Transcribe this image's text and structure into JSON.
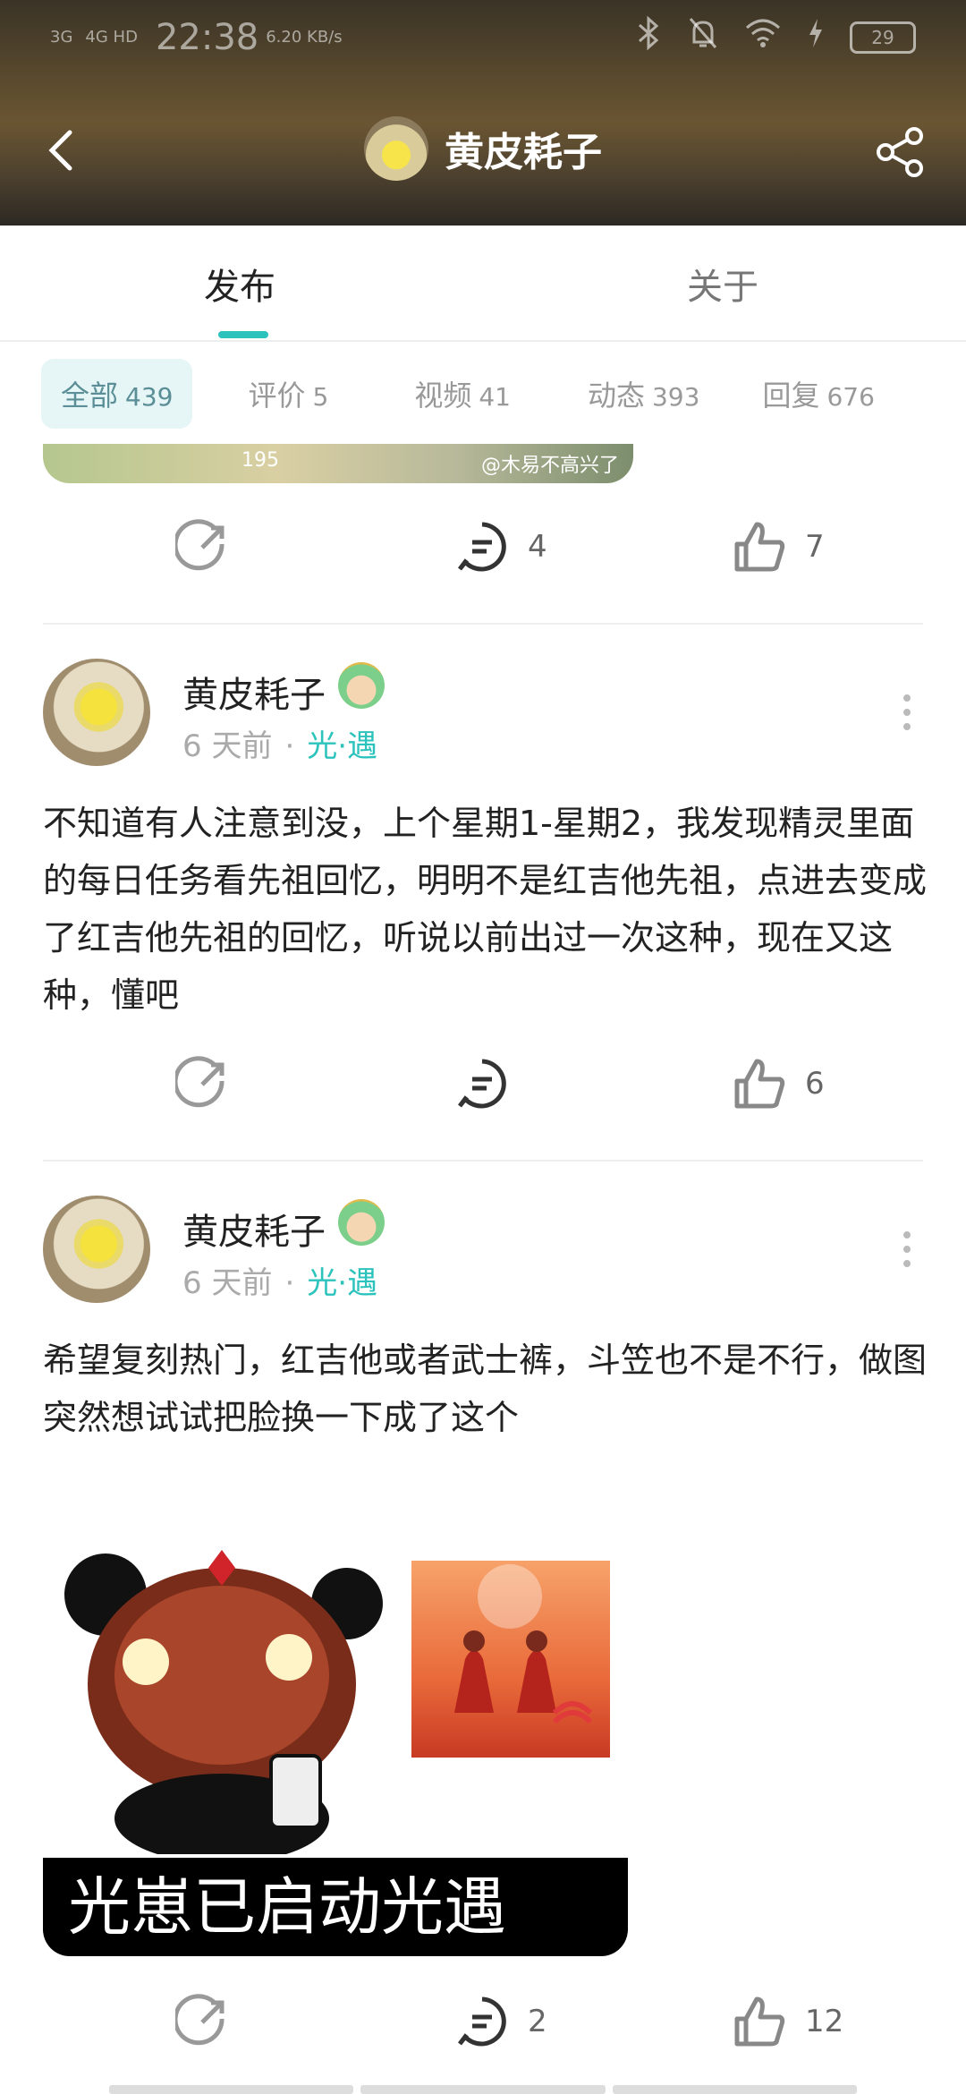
{
  "status": {
    "signal1": "3G",
    "signal2": "4G HD",
    "time": "22:38",
    "rate": "6.20 KB/s",
    "battery": "29"
  },
  "header": {
    "title": "黄皮耗子"
  },
  "tabs": [
    {
      "label": "发布"
    },
    {
      "label": "关于"
    }
  ],
  "filters": [
    {
      "label": "全部",
      "count": "439"
    },
    {
      "label": "评价",
      "count": "5"
    },
    {
      "label": "视频",
      "count": "41"
    },
    {
      "label": "动态",
      "count": "393"
    },
    {
      "label": "回复",
      "count": "676"
    }
  ],
  "top_post": {
    "image_text_a": "195",
    "image_text_b": "@木易不高兴了啊",
    "comments": "4",
    "likes": "7"
  },
  "posts": [
    {
      "author": "黄皮耗子",
      "time": "6 天前",
      "dot": "·",
      "topic": "光·遇",
      "text": "不知道有人注意到没，上个星期1-星期2，我发现精灵里面的每日任务看先祖回忆，明明不是红吉他先祖，点进去变成了红吉他先祖的回忆，听说以前出过一次这种，现在又这种，懂吧",
      "comments": "",
      "likes": "6"
    },
    {
      "author": "黄皮耗子",
      "time": "6 天前",
      "dot": "·",
      "topic": "光·遇",
      "text": "希望复刻热门，红吉他或者武士裤，斗笠也不是不行，做图突然想试试把脸换一下成了这个",
      "image_caption": "光崽已启动光遇",
      "comments": "2",
      "likes": "12"
    }
  ]
}
